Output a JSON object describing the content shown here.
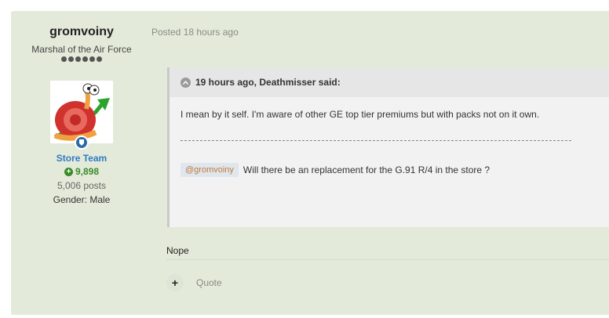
{
  "author": {
    "name": "gromvoiny",
    "title": "Marshal of the Air Force",
    "pips": 6,
    "group": "Store Team",
    "reputation": "9,898",
    "posts": "5,006 posts",
    "gender": "Gender: Male"
  },
  "post": {
    "posted": "Posted 18 hours ago",
    "quote": {
      "header": "19 hours ago, Deathmisser said:",
      "line1": "I mean by it self.  I'm aware of other GE top tier premiums but with packs not on it own.",
      "separator": "--------------------------------------------------------------------------------------------------------------------------------",
      "mention": "@gromvoiny",
      "line2": "Will there be an replacement for the G.91 R/4 in the store ?"
    },
    "reply": "Nope",
    "actions": {
      "plus": "+",
      "quote": "Quote"
    }
  }
}
